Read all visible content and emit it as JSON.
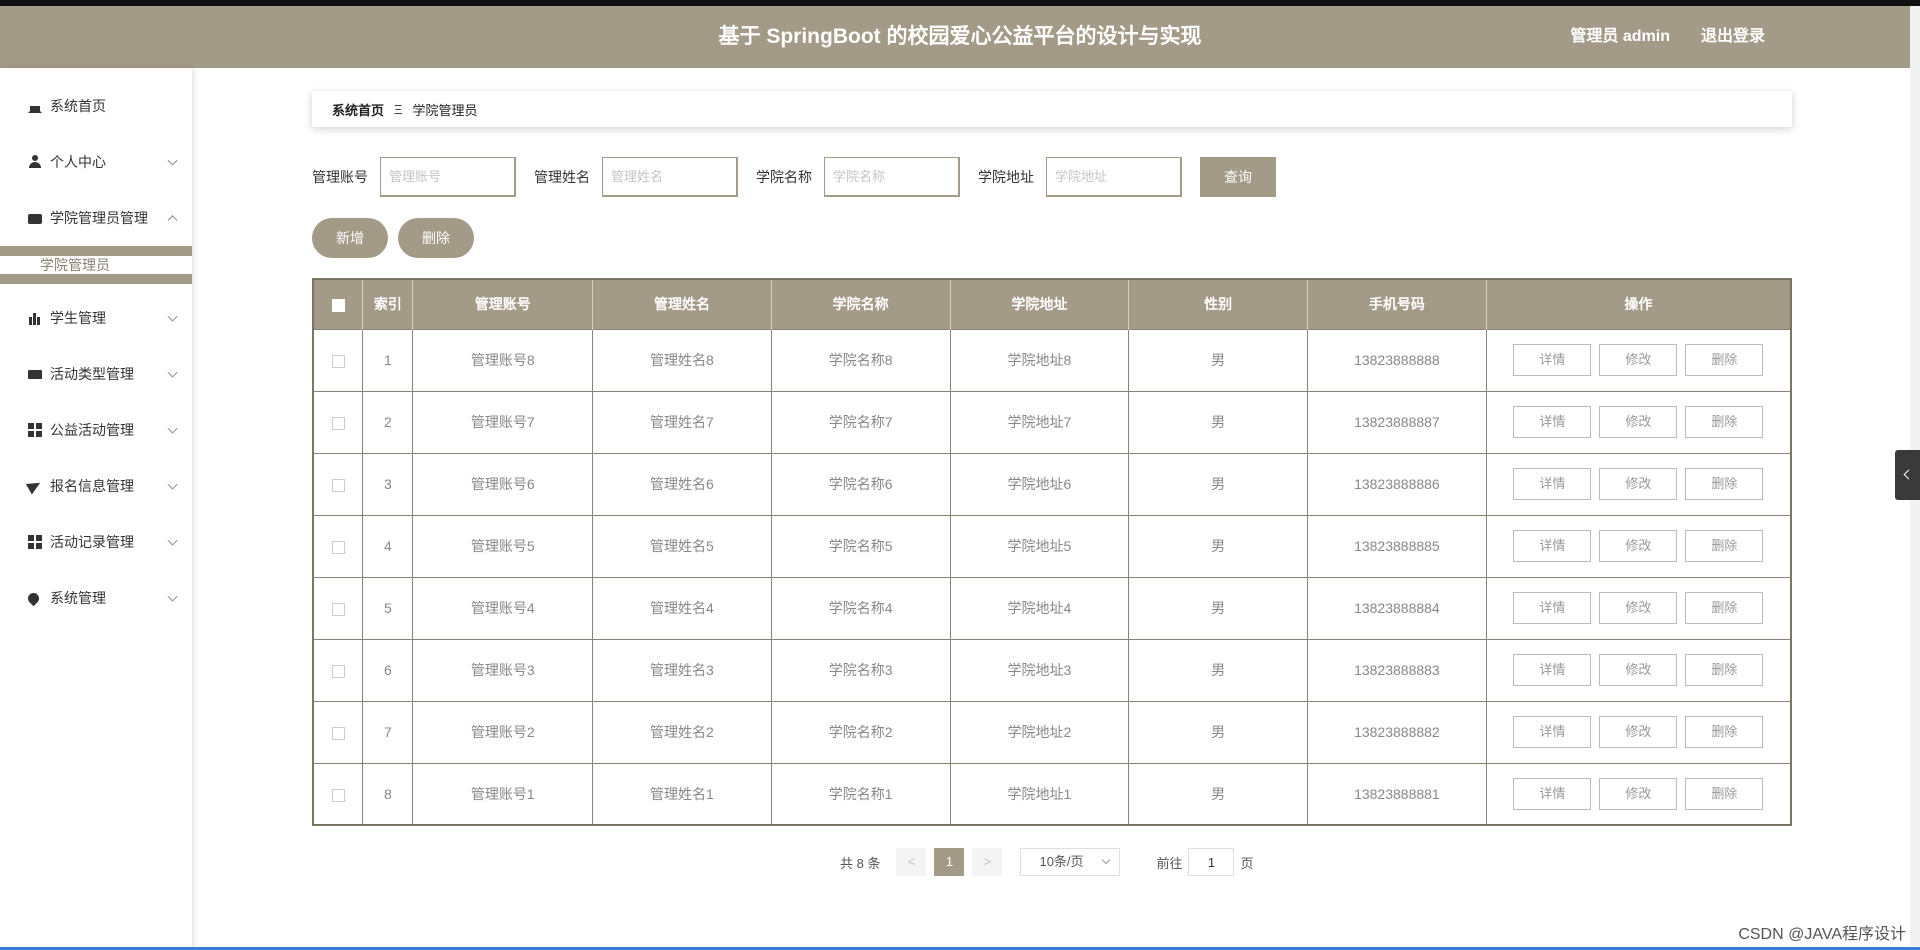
{
  "header": {
    "title": "基于 SpringBoot 的校园爱心公益平台的设计与实现",
    "user": "管理员 admin",
    "logout": "退出登录"
  },
  "sidebar": {
    "items": [
      {
        "label": "系统首页",
        "icon": "home-icon",
        "expandable": false
      },
      {
        "label": "个人中心",
        "icon": "user-icon",
        "expandable": true
      },
      {
        "label": "学院管理员管理",
        "icon": "chat-icon",
        "expandable": true,
        "expanded": true
      },
      {
        "label": "学生管理",
        "icon": "bar-chart-icon",
        "expandable": true
      },
      {
        "label": "活动类型管理",
        "icon": "ticket-icon",
        "expandable": true
      },
      {
        "label": "公益活动管理",
        "icon": "grid-icon",
        "expandable": true
      },
      {
        "label": "报名信息管理",
        "icon": "send-icon",
        "expandable": true
      },
      {
        "label": "活动记录管理",
        "icon": "grid-icon",
        "expandable": true
      },
      {
        "label": "系统管理",
        "icon": "location-icon",
        "expandable": true
      }
    ],
    "active_sub": "学院管理员"
  },
  "breadcrumb": {
    "home": "系统首页",
    "separator": "Ξ",
    "current": "学院管理员"
  },
  "search": {
    "fields": [
      {
        "label": "管理账号",
        "placeholder": "管理账号"
      },
      {
        "label": "管理姓名",
        "placeholder": "管理姓名"
      },
      {
        "label": "学院名称",
        "placeholder": "学院名称"
      },
      {
        "label": "学院地址",
        "placeholder": "学院地址"
      }
    ],
    "query_button": "查询"
  },
  "actions": {
    "add": "新增",
    "delete": "删除"
  },
  "table": {
    "columns": [
      "索引",
      "管理账号",
      "管理姓名",
      "学院名称",
      "学院地址",
      "性别",
      "手机号码",
      "操作"
    ],
    "rows": [
      {
        "index": "1",
        "account": "管理账号8",
        "name": "管理姓名8",
        "college": "学院名称8",
        "address": "学院地址8",
        "gender": "男",
        "phone": "13823888888"
      },
      {
        "index": "2",
        "account": "管理账号7",
        "name": "管理姓名7",
        "college": "学院名称7",
        "address": "学院地址7",
        "gender": "男",
        "phone": "13823888887"
      },
      {
        "index": "3",
        "account": "管理账号6",
        "name": "管理姓名6",
        "college": "学院名称6",
        "address": "学院地址6",
        "gender": "男",
        "phone": "13823888886"
      },
      {
        "index": "4",
        "account": "管理账号5",
        "name": "管理姓名5",
        "college": "学院名称5",
        "address": "学院地址5",
        "gender": "男",
        "phone": "13823888885"
      },
      {
        "index": "5",
        "account": "管理账号4",
        "name": "管理姓名4",
        "college": "学院名称4",
        "address": "学院地址4",
        "gender": "男",
        "phone": "13823888884"
      },
      {
        "index": "6",
        "account": "管理账号3",
        "name": "管理姓名3",
        "college": "学院名称3",
        "address": "学院地址3",
        "gender": "男",
        "phone": "13823888883"
      },
      {
        "index": "7",
        "account": "管理账号2",
        "name": "管理姓名2",
        "college": "学院名称2",
        "address": "学院地址2",
        "gender": "男",
        "phone": "13823888882"
      },
      {
        "index": "8",
        "account": "管理账号1",
        "name": "管理姓名1",
        "college": "学院名称1",
        "address": "学院地址1",
        "gender": "男",
        "phone": "13823888881"
      }
    ],
    "row_actions": {
      "detail": "详情",
      "edit": "修改",
      "delete": "删除"
    }
  },
  "pagination": {
    "total": "共 8 条",
    "prev": "<",
    "page": "1",
    "next": ">",
    "page_size": "10条/页",
    "goto_prefix": "前往",
    "goto_value": "1",
    "goto_suffix": "页"
  },
  "watermark": "CSDN @JAVA程序设计",
  "colors": {
    "accent": "#a49a88",
    "table_border": "#7d7566"
  }
}
